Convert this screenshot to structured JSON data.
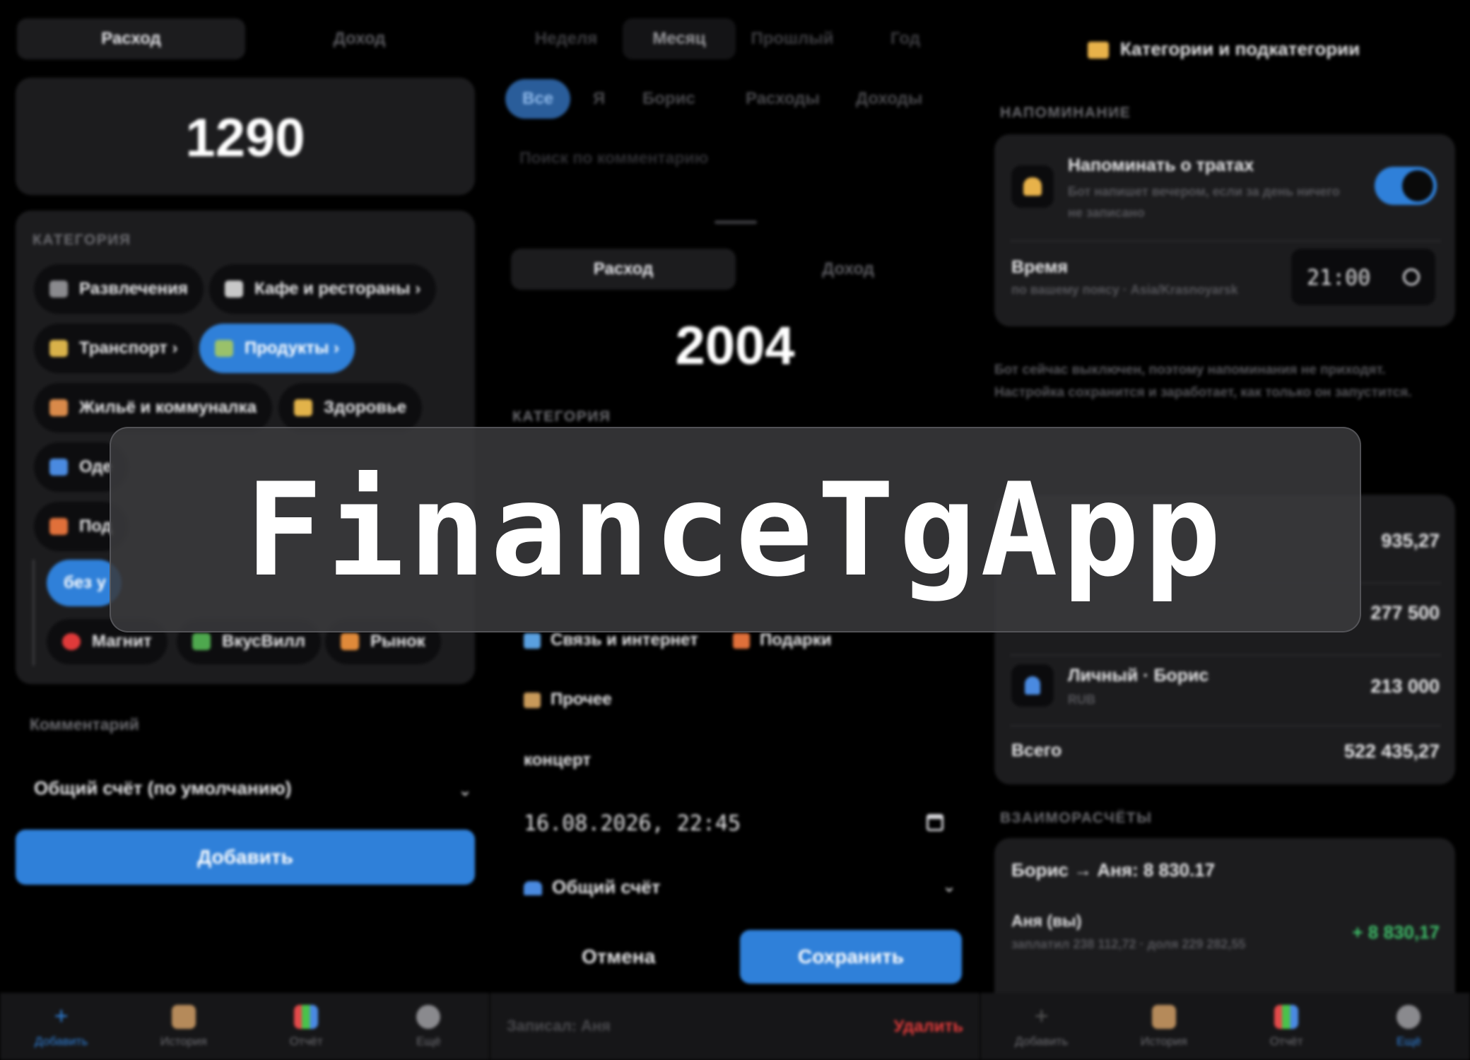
{
  "overlay": {
    "title": "FinanceTgApp"
  },
  "p1": {
    "type_tabs": [
      "Расход",
      "Доход"
    ],
    "amount": "1290",
    "category_label": "КАТЕГОРИЯ",
    "chips": [
      {
        "label": "Развлечения",
        "color": "#8a8a8e"
      },
      {
        "label": "Кафе и рестораны ›",
        "color": "#c8c8c8"
      },
      {
        "label": "Транспорт ›",
        "color": "#d9b24a"
      },
      {
        "label": "Продукты ›",
        "color": "#9ac16a",
        "active": true
      },
      {
        "label": "Жильё и коммуналка",
        "color": "#d98a4a"
      },
      {
        "label": "Здоровье",
        "color": "#e2b34a"
      },
      {
        "label": "Оде",
        "color": "#4a8ae0"
      },
      {
        "label": "Под",
        "color": "#e0703a"
      },
      {
        "label": "без у",
        "color": "#2f80d9",
        "active": true
      },
      {
        "label": "Магнит",
        "color": "#e03a3a"
      },
      {
        "label": "ВкусВилл",
        "color": "#4ea84e"
      },
      {
        "label": "Рынок",
        "color": "#e08a3a"
      }
    ],
    "comment_placeholder": "Комментарий",
    "account": "Общий счёт (по умолчанию)",
    "add_button": "Добавить",
    "tabs": [
      {
        "label": "Добавить",
        "icon": "plus-icon",
        "glyph": "+",
        "active": true
      },
      {
        "label": "История",
        "icon": "scroll-icon",
        "glyph": ""
      },
      {
        "label": "Отчёт",
        "icon": "chart-icon",
        "glyph": ""
      },
      {
        "label": "Ещё",
        "icon": "gear-icon",
        "glyph": ""
      }
    ]
  },
  "p2": {
    "period_tabs": [
      "Неделя",
      "Месяц",
      "Прошлый",
      "Год"
    ],
    "filters": [
      "Все",
      "Я",
      "Борис",
      "Расходы",
      "Доходы"
    ],
    "search_placeholder": "Поиск по комментарию",
    "type_tabs": [
      "Расход",
      "Доход"
    ],
    "amount": "2004",
    "category_label": "КАТЕГОРИЯ",
    "chips": [
      {
        "label": "Связь и интернет",
        "color": "#5aa0e0"
      },
      {
        "label": "Подарки",
        "color": "#e0703a"
      },
      {
        "label": "Прочее",
        "color": "#c89a5a"
      }
    ],
    "comment": "концерт",
    "datetime": "16.08.2026, 22:45",
    "account": "Общий счёт",
    "cancel": "Отмена",
    "save": "Сохранить",
    "recorded_by": "Записал: Аня",
    "delete": "Удалить"
  },
  "p3": {
    "header": "Категории и подкатегории",
    "reminder_label": "НАПОМИНАНИЕ",
    "remind_title": "Напоминать о тратах",
    "remind_sub": "Бот напишет вечером, если за день ничего не записано",
    "time_label": "Время",
    "time_sub": "по вашему поясу · Asia/Krasnoyarsk",
    "time_value": "21:00",
    "bot_note": "Бот сейчас выключен, поэтому напоминания не приходят. Настройка сохранится и заработает, как только он запустится.",
    "accounts": [
      {
        "value": "935,27"
      },
      {
        "value": "277 500"
      },
      {
        "name": "Личный · Борис",
        "currency": "RUB",
        "value": "213 000"
      }
    ],
    "total_label": "Всего",
    "total_value": "522 435,27",
    "settle_label": "ВЗАИМОРАСЧЁТЫ",
    "settle_title": "Борис → Аня: 8 830.17",
    "settle_person": "Аня (вы)",
    "settle_sub": "заплатил 238 112,72 · доля 229 282,55",
    "settle_value": "+ 8 830,17",
    "tabs": [
      {
        "label": "Добавить",
        "icon": "plus-icon",
        "glyph": "+"
      },
      {
        "label": "История",
        "icon": "scroll-icon",
        "glyph": ""
      },
      {
        "label": "Отчёт",
        "icon": "chart-icon",
        "glyph": ""
      },
      {
        "label": "Ещё",
        "icon": "gear-icon",
        "glyph": "",
        "active": true
      }
    ]
  }
}
